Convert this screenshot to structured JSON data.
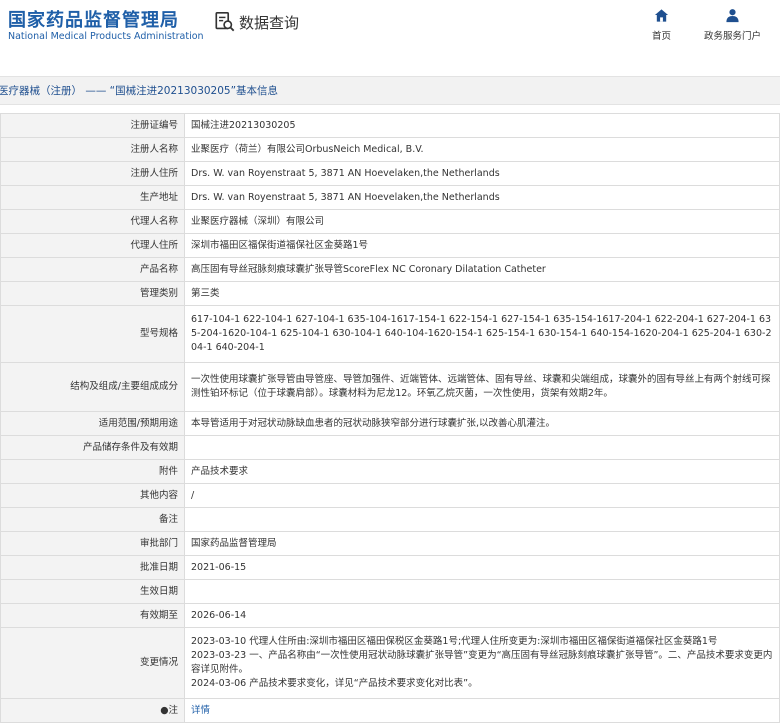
{
  "header": {
    "logo_cn": "国家药品监督管理局",
    "logo_en": "National Medical Products Administration",
    "query_label": "数据查询",
    "nav": [
      {
        "label": "首页",
        "icon": "home-icon"
      },
      {
        "label": "政务服务门户",
        "icon": "user-icon"
      }
    ]
  },
  "breadcrumb": "医疗器械（注册） —— “国械注进20213030205”基本信息",
  "rows": [
    {
      "label": "注册证编号",
      "value": "国械注进20213030205"
    },
    {
      "label": "注册人名称",
      "value": "业聚医疗（荷兰）有限公司OrbusNeich Medical, B.V."
    },
    {
      "label": "注册人住所",
      "value": "Drs. W. van Royenstraat 5, 3871 AN Hoevelaken,the Netherlands"
    },
    {
      "label": "生产地址",
      "value": "Drs. W. van Royenstraat 5, 3871 AN Hoevelaken,the Netherlands"
    },
    {
      "label": "代理人名称",
      "value": "业聚医疗器械（深圳）有限公司"
    },
    {
      "label": "代理人住所",
      "value": "深圳市福田区福保街道福保社区金葵路1号"
    },
    {
      "label": "产品名称",
      "value": "高压固有导丝冠脉刻痕球囊扩张导管ScoreFlex NC Coronary Dilatation Catheter"
    },
    {
      "label": "管理类别",
      "value": "第三类"
    },
    {
      "label": "型号规格",
      "value": "617-104-1 622-104-1 627-104-1 635-104-1617-154-1 622-154-1 627-154-1 635-154-1617-204-1 622-204-1 627-204-1 635-204-1620-104-1 625-104-1 630-104-1 640-104-1620-154-1 625-154-1 630-154-1 640-154-1620-204-1 625-204-1 630-204-1 640-204-1"
    },
    {
      "label": "结构及组成/主要组成成分",
      "value": "一次性使用球囊扩张导管由导管座、导管加强件、近端管体、远端管体、固有导丝、球囊和尖端组成，球囊外的固有导丝上有两个射线可探测性铂环标记（位于球囊肩部）。球囊材料为尼龙12。环氧乙烷灭菌，一次性使用，货架有效期2年。"
    },
    {
      "label": "适用范围/预期用途",
      "value": "本导管适用于对冠状动脉缺血患者的冠状动脉狭窄部分进行球囊扩张,以改善心肌灌注。"
    },
    {
      "label": "产品储存条件及有效期",
      "value": ""
    },
    {
      "label": "附件",
      "value": "产品技术要求"
    },
    {
      "label": "其他内容",
      "value": "/"
    },
    {
      "label": "备注",
      "value": ""
    },
    {
      "label": "审批部门",
      "value": "国家药品监督管理局"
    },
    {
      "label": "批准日期",
      "value": "2021-06-15"
    },
    {
      "label": "生效日期",
      "value": ""
    },
    {
      "label": "有效期至",
      "value": "2026-06-14"
    }
  ],
  "changes": {
    "label": "变更情况",
    "lines": [
      "2023-03-10 代理人住所由:深圳市福田区福田保税区金葵路1号;代理人住所变更为:深圳市福田区福保街道福保社区金葵路1号",
      "2023-03-23 一、产品名称由“一次性使用冠状动脉球囊扩张导管”变更为“高压固有导丝冠脉刻痕球囊扩张导管”。二、产品技术要求变更内容详见附件。",
      "2024-03-06 产品技术要求变化，详见“产品技术要求变化对比表”。"
    ]
  },
  "note": {
    "label": "●注",
    "value": "详情"
  }
}
